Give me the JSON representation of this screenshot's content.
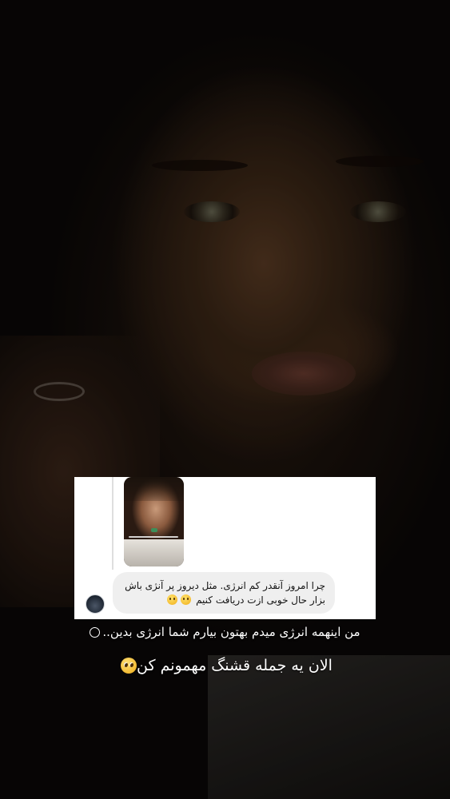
{
  "story": {
    "background_description_icon": "portrait-photo",
    "reply_card": {
      "comment_line1": "چرا امروز آنقدر کم انرژی.  مثل دیروز پر آنژی باش",
      "comment_line2": "بزار حال خوبی ازت دریافت کنیم",
      "comment_emojis": [
        "slight-smile-emoji",
        "slight-smile-emoji"
      ]
    },
    "caption_line1": "من اینهمه انرژی میدم بهتون بیارم شما انرژی بدین..",
    "caption_line2": "الان یه جمله قشنگ مهمونم کن",
    "caption_line1_emoji": "slight-smile-outline-emoji",
    "caption_line2_emoji": "pleading-face-emoji"
  },
  "colors": {
    "background": "#0b0807",
    "card": "#ffffff",
    "bubble": "#efefef",
    "caption_text": "#ffffff"
  }
}
